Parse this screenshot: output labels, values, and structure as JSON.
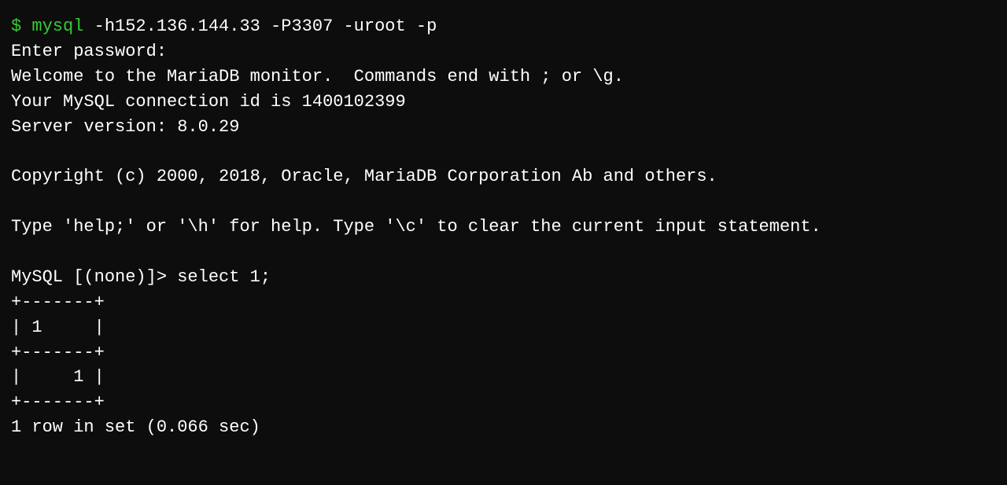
{
  "terminal": {
    "lines": [
      {
        "type": "command",
        "prompt": "$ ",
        "command": "mysql -h152.136.144.33 -P3307 -uroot -p"
      },
      {
        "type": "normal",
        "text": "Enter password:"
      },
      {
        "type": "normal",
        "text": "Welcome to the MariaDB monitor.  Commands end with ; or \\g."
      },
      {
        "type": "normal",
        "text": "Your MySQL connection id is 1400102399"
      },
      {
        "type": "normal",
        "text": "Server version: 8.0.29"
      },
      {
        "type": "empty"
      },
      {
        "type": "normal",
        "text": "Copyright (c) 2000, 2018, Oracle, MariaDB Corporation Ab and others."
      },
      {
        "type": "empty"
      },
      {
        "type": "normal",
        "text": "Type 'help;' or '\\h' for help. Type '\\c' to clear the current input statement."
      },
      {
        "type": "empty"
      },
      {
        "type": "normal",
        "text": "MySQL [(none)]> select 1;"
      },
      {
        "type": "normal",
        "text": "+-------+"
      },
      {
        "type": "normal",
        "text": "| 1     |"
      },
      {
        "type": "normal",
        "text": "+-------+"
      },
      {
        "type": "normal",
        "text": "|     1 |"
      },
      {
        "type": "normal",
        "text": "+-------+"
      },
      {
        "type": "normal",
        "text": "1 row in set (0.066 sec)"
      }
    ],
    "prompt_symbol": "$",
    "command_text": "mysql -h152.136.144.33 -P3307 -uroot -p"
  }
}
